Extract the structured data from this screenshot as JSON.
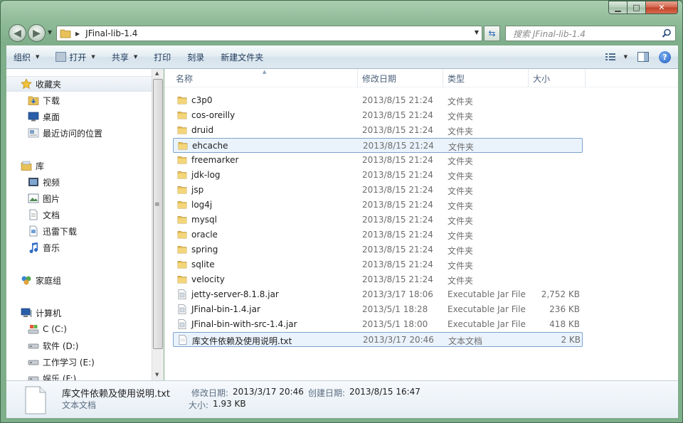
{
  "window": {
    "caption_buttons": {
      "minimize": "▁",
      "maximize": "□",
      "close": "✕"
    }
  },
  "address": {
    "path": "JFinal-lib-1.4",
    "search_placeholder": "搜索 JFinal-lib-1.4"
  },
  "toolbar": {
    "organize": "组织",
    "open": "打开",
    "share": "共享",
    "print": "打印",
    "burn": "刻录",
    "new_folder": "新建文件夹"
  },
  "nav": {
    "favorites": "收藏夹",
    "downloads": "下载",
    "desktop": "桌面",
    "recent": "最近访问的位置",
    "libraries": "库",
    "videos": "视频",
    "pictures": "图片",
    "documents": "文档",
    "xunlei": "迅雷下载",
    "music": "音乐",
    "homegroup": "家庭组",
    "computer": "计算机",
    "drive_c": "C (C:)",
    "drive_d": "软件 (D:)",
    "drive_e": "工作学习 (E:)",
    "drive_f": "娱乐 (F:)"
  },
  "columns": {
    "name": "名称",
    "modified": "修改日期",
    "type": "类型",
    "size": "大小"
  },
  "files": [
    {
      "name": "c3p0",
      "modified": "2013/8/15 21:24",
      "type": "文件夹",
      "size": "",
      "kind": "folder"
    },
    {
      "name": "cos-oreilly",
      "modified": "2013/8/15 21:24",
      "type": "文件夹",
      "size": "",
      "kind": "folder"
    },
    {
      "name": "druid",
      "modified": "2013/8/15 21:24",
      "type": "文件夹",
      "size": "",
      "kind": "folder"
    },
    {
      "name": "ehcache",
      "modified": "2013/8/15 21:24",
      "type": "文件夹",
      "size": "",
      "kind": "folder"
    },
    {
      "name": "freemarker",
      "modified": "2013/8/15 21:24",
      "type": "文件夹",
      "size": "",
      "kind": "folder"
    },
    {
      "name": "jdk-log",
      "modified": "2013/8/15 21:24",
      "type": "文件夹",
      "size": "",
      "kind": "folder"
    },
    {
      "name": "jsp",
      "modified": "2013/8/15 21:24",
      "type": "文件夹",
      "size": "",
      "kind": "folder"
    },
    {
      "name": "log4j",
      "modified": "2013/8/15 21:24",
      "type": "文件夹",
      "size": "",
      "kind": "folder"
    },
    {
      "name": "mysql",
      "modified": "2013/8/15 21:24",
      "type": "文件夹",
      "size": "",
      "kind": "folder"
    },
    {
      "name": "oracle",
      "modified": "2013/8/15 21:24",
      "type": "文件夹",
      "size": "",
      "kind": "folder"
    },
    {
      "name": "spring",
      "modified": "2013/8/15 21:24",
      "type": "文件夹",
      "size": "",
      "kind": "folder"
    },
    {
      "name": "sqlite",
      "modified": "2013/8/15 21:24",
      "type": "文件夹",
      "size": "",
      "kind": "folder"
    },
    {
      "name": "velocity",
      "modified": "2013/8/15 21:24",
      "type": "文件夹",
      "size": "",
      "kind": "folder"
    },
    {
      "name": "jetty-server-8.1.8.jar",
      "modified": "2013/3/17 18:06",
      "type": "Executable Jar File",
      "size": "2,752 KB",
      "kind": "jar"
    },
    {
      "name": "JFinal-bin-1.4.jar",
      "modified": "2013/5/1 18:28",
      "type": "Executable Jar File",
      "size": "236 KB",
      "kind": "jar"
    },
    {
      "name": "JFinal-bin-with-src-1.4.jar",
      "modified": "2013/5/1 18:00",
      "type": "Executable Jar File",
      "size": "418 KB",
      "kind": "jar"
    },
    {
      "name": "库文件依赖及使用说明.txt",
      "modified": "2013/3/17 20:46",
      "type": "文本文档",
      "size": "2 KB",
      "kind": "txt"
    }
  ],
  "details": {
    "filename": "库文件依赖及使用说明.txt",
    "filetype": "文本文档",
    "modified_label": "修改日期:",
    "modified_value": "2013/3/17 20:46",
    "created_label": "创建日期:",
    "created_value": "2013/8/15 16:47",
    "size_label": "大小:",
    "size_value": "1.93 KB"
  },
  "colors": {
    "accent": "#2c64b8",
    "selection_border": "#7da2ce",
    "selection_fill": "#eaf3fc"
  }
}
